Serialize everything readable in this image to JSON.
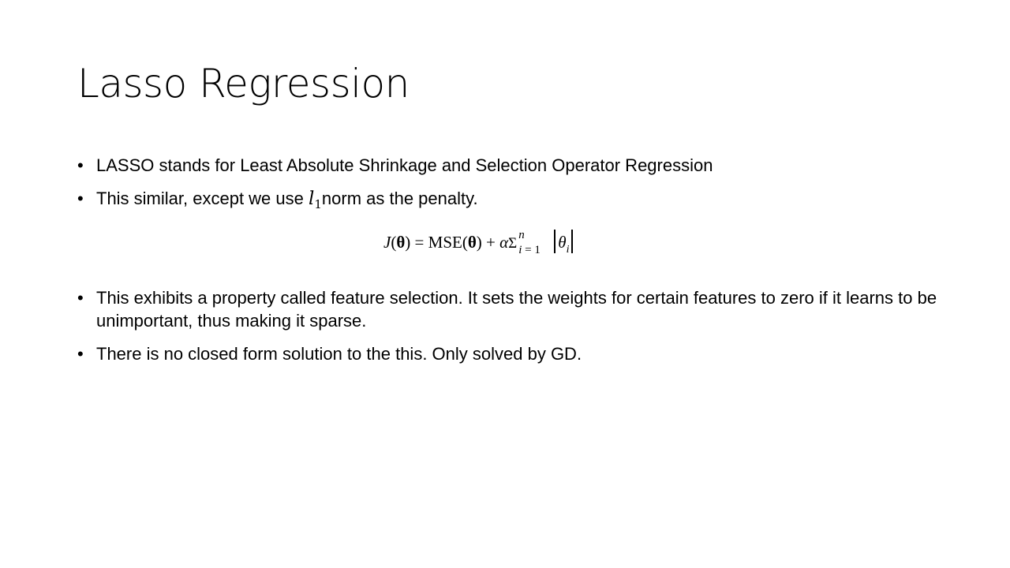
{
  "slide": {
    "title": "Lasso Regression",
    "bullets_top": [
      {
        "dot": "•",
        "text": "LASSO stands for Least Absolute Shrinkage and Selection Operator Regression"
      },
      {
        "dot": "•",
        "text_before": "This similar, except we use ",
        "math_symbol": "l",
        "math_subscript": "1",
        "text_after": "norm as the penalty."
      }
    ],
    "formula": {
      "lhs_fn": "J",
      "lhs_open": "(",
      "lhs_arg": "θ",
      "lhs_close": ")",
      "equals": " = ",
      "mse": "MSE",
      "mse_open": "(",
      "mse_arg": "θ",
      "mse_close": ")",
      "plus": " + ",
      "alpha": "α",
      "sum": "Σ",
      "sum_upper": "n",
      "sum_lower_var": "i",
      "sum_lower_rest": " = 1",
      "term": "θ",
      "term_sub": "i"
    },
    "bullets_bottom": [
      {
        "dot": "•",
        "text": "This exhibits a property called feature selection. It sets the weights for certain features to zero if it learns to be unimportant, thus making it sparse."
      },
      {
        "dot": "•",
        "text": "There is no closed form solution to the this. Only solved by GD."
      }
    ]
  }
}
